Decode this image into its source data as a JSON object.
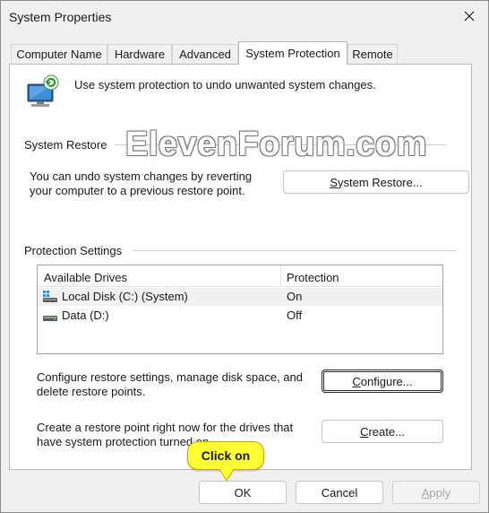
{
  "window": {
    "title": "System Properties",
    "close_icon": "close-icon"
  },
  "tabs": [
    {
      "label": "Computer Name",
      "active": false
    },
    {
      "label": "Hardware",
      "active": false
    },
    {
      "label": "Advanced",
      "active": false
    },
    {
      "label": "System Protection",
      "active": true
    },
    {
      "label": "Remote",
      "active": false
    }
  ],
  "intro": {
    "icon": "system-protection-icon",
    "text": "Use system protection to undo unwanted system changes."
  },
  "system_restore": {
    "heading": "System Restore",
    "description_line1": "You can undo system changes by reverting",
    "description_line2": "your computer to a previous restore point.",
    "button_label": "System Restore..."
  },
  "watermark": "ElevenForum.com",
  "protection": {
    "heading": "Protection Settings",
    "columns": [
      "Available Drives",
      "Protection"
    ],
    "drives": [
      {
        "name": "Local Disk (C:) (System)",
        "protection": "On",
        "icon": "system-drive-icon",
        "selected": true
      },
      {
        "name": "Data (D:)",
        "protection": "Off",
        "icon": "drive-icon",
        "selected": false
      }
    ],
    "configure_text_line1": "Configure restore settings, manage disk space, and",
    "configure_text_line2": "delete restore points.",
    "configure_button": "Configure...",
    "create_text_line1": "Create a restore point right now for the drives that",
    "create_text_line2": "have system protection turned on.",
    "create_button": "Create..."
  },
  "footer": {
    "ok": "OK",
    "cancel": "Cancel",
    "apply": "Apply"
  },
  "callout": {
    "text": "Click on",
    "color": "#ffff33"
  }
}
